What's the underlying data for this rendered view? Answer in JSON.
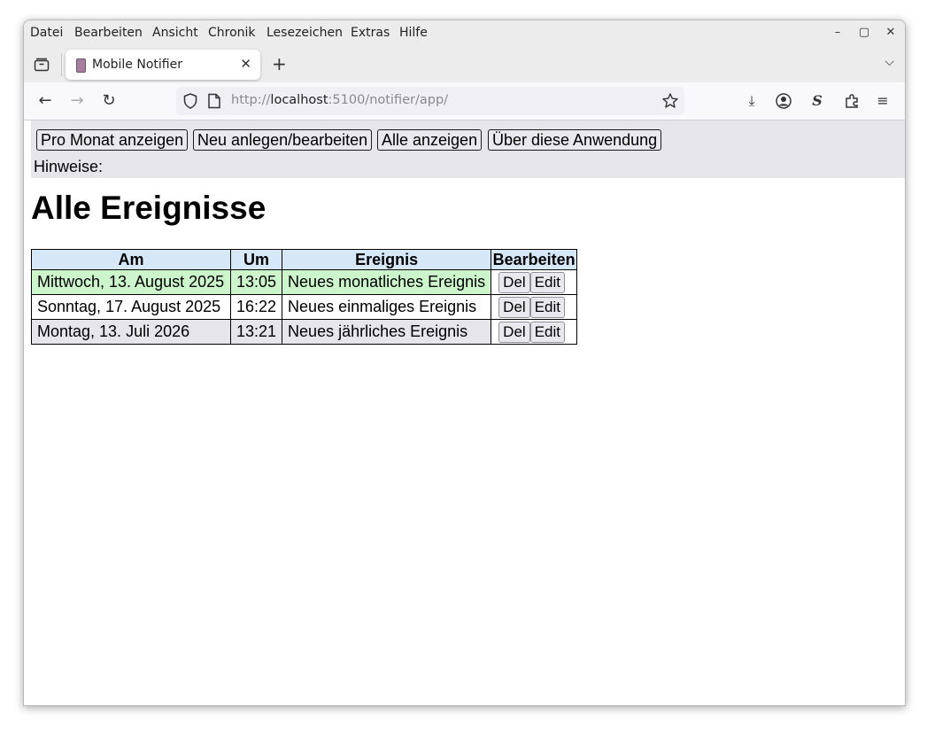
{
  "browser": {
    "menu": [
      "Datei",
      "Bearbeiten",
      "Ansicht",
      "Chronik",
      "Lesezeichen",
      "Extras",
      "Hilfe"
    ],
    "tab_title": "Mobile Notifier",
    "url_prefix": "http://",
    "url_host": "localhost",
    "url_rest": ":5100/notifier/app/"
  },
  "page": {
    "buttons": [
      "Pro Monat anzeigen",
      "Neu anlegen/bearbeiten",
      "Alle anzeigen",
      "Über diese Anwendung"
    ],
    "hinweise": "Hinweise:",
    "heading": "Alle Ereignisse",
    "table": {
      "headers": [
        "Am",
        "Um",
        "Ereignis",
        "Bearbeiten"
      ],
      "rows": [
        {
          "date": "Mittwoch, 13. August 2025",
          "time": "13:05",
          "event": "Neues monatliches Ereignis",
          "bg": "#ccf5cc"
        },
        {
          "date": "Sonntag, 17. August 2025",
          "time": "16:22",
          "event": "Neues einmaliges Ereignis",
          "bg": "#ffffff"
        },
        {
          "date": "Montag, 13. Juli 2026",
          "time": "13:21",
          "event": "Neues jährliches Ereignis",
          "bg": "#e5e5ea"
        }
      ],
      "del_label": "Del",
      "edit_label": "Edit"
    }
  }
}
